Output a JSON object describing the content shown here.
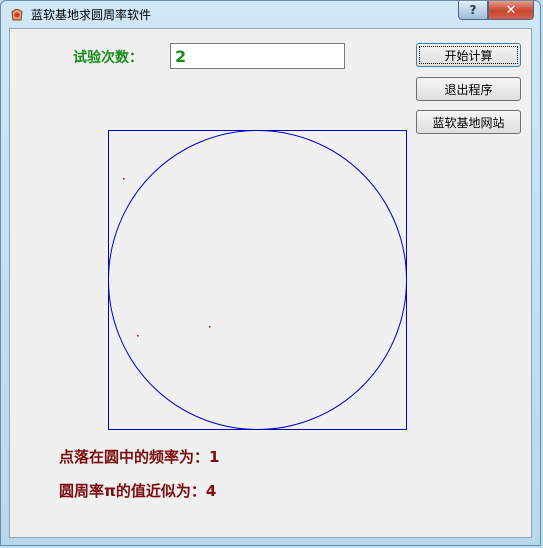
{
  "window": {
    "title": "蓝软基地求圆周率软件",
    "help_label": "?",
    "close_label": "✕"
  },
  "form": {
    "trials_label": "试验次数：",
    "trials_value": "2"
  },
  "buttons": {
    "start": "开始计算",
    "exit": "退出程序",
    "website": "蓝软基地网站"
  },
  "results": {
    "frequency_line": "点落在圆中的频率为：1",
    "pi_line": "圆周率π的值近似为：4"
  },
  "colors": {
    "label_green": "#1a8c1a",
    "result_red": "#7b0f0f",
    "plot_blue": "#0000c8",
    "dot_red": "#cc0000"
  },
  "icons": {
    "app": "app-icon",
    "help": "help-icon",
    "close": "close-icon"
  }
}
